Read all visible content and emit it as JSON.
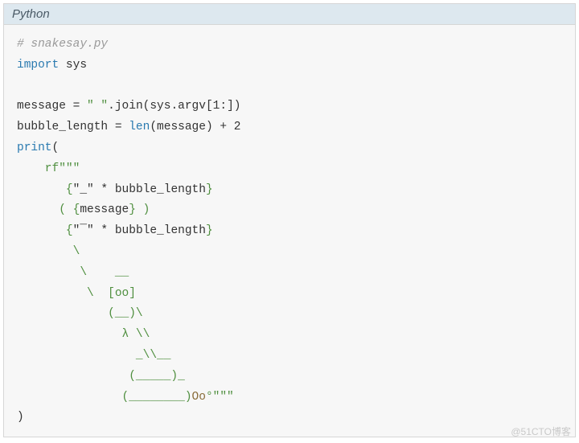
{
  "header": {
    "language_label": "Python"
  },
  "code": {
    "comment": "# snakesay.py",
    "kw_import": "import",
    "mod_sys": "sys",
    "var_message": "message",
    "eq1": " = ",
    "str_space": "\" \"",
    "dot_join": ".join(sys.argv[",
    "slice": "1:",
    "close_join": "])",
    "var_bubble": "bubble_length",
    "eq2": " = ",
    "fn_len": "len",
    "len_open": "(message) ",
    "plus2": "+ 2",
    "fn_print": "print",
    "print_open": "(",
    "rf_prefix": "    rf\"\"\"",
    "line_top_open": "       {",
    "line_top_expr": "\"_\" * bubble_length",
    "line_top_close": "}",
    "line_msg_open": "      ( {",
    "line_msg_expr": "message",
    "line_msg_close": "} )",
    "line_bot_open": "       {",
    "line_bot_expr": "\"¯\" * bubble_length",
    "line_bot_close": "}",
    "art1": "        \\",
    "art2": "         \\    __",
    "art3": "          \\  [oo]",
    "art4": "             (__)\\",
    "art5": "               λ \\\\",
    "art6": "                 _\\\\__",
    "art7": "                (_____)_",
    "art8_a": "               (________)",
    "art8_b": "Oo",
    "art8_c": "°\"\"\"",
    "print_close": ")"
  },
  "watermark": {
    "text": "@51CTO博客"
  }
}
